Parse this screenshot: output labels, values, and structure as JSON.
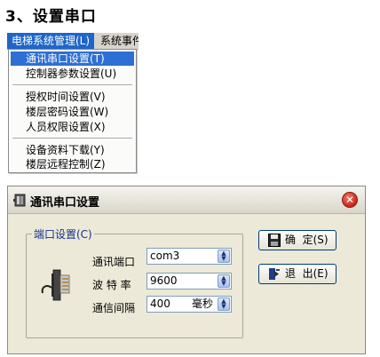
{
  "heading": "3、设置串口",
  "menubar": {
    "active_menu": "电梯系统管理(L)",
    "next_menu": "系统事件"
  },
  "menu_items": [
    "通讯串口设置(T)",
    "控制器参数设置(U)",
    "授权时间设置(V)",
    "楼层密码设置(W)",
    "人员权限设置(X)",
    "设备资料下载(Y)",
    "楼层远程控制(Z)"
  ],
  "dialog": {
    "title": "通讯串口设置",
    "group_label": "端口设置(C)",
    "port_label": "通讯端口",
    "port_value": "com3",
    "baud_label": "波 特 率",
    "baud_value": "9600",
    "interval_label": "通信间隔",
    "interval_value": "400",
    "interval_unit": "毫秒",
    "ok_label": "确  定(S)",
    "exit_label": "退  出(E)"
  },
  "colors": {
    "menu_highlight": "#2e6fd4",
    "dialog_bg": "#ece9d8",
    "close_button": "#c9261a"
  },
  "icons": [
    "dialog-icon",
    "close-icon",
    "serial-plug-icon",
    "save-icon",
    "exit-icon",
    "spin-up-down-icon"
  ]
}
